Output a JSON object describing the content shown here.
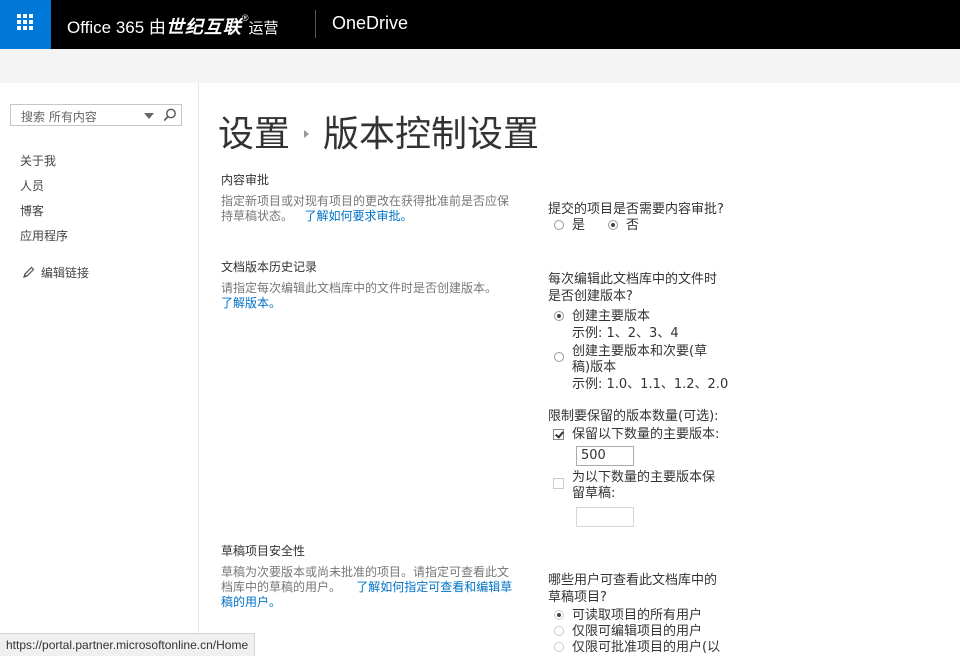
{
  "topbar": {
    "brand_prefix": "Office 365 由",
    "brand_mark": "世纪互联",
    "brand_reg": "®",
    "brand_suffix": "运营",
    "app_name": "OneDrive"
  },
  "search": {
    "placeholder": "搜索 所有内容"
  },
  "nav": {
    "items": [
      "关于我",
      "人员",
      "博客",
      "应用程序"
    ],
    "edit_links": "编辑链接"
  },
  "breadcrumb": {
    "parent": "设置",
    "current": "版本控制设置"
  },
  "sections": {
    "content_approval": {
      "heading": "内容审批",
      "description": "指定新项目或对现有项目的更改在获得批准前是否应保持草稿状态。",
      "link": "了解如何要求审批。",
      "question": "提交的项目是否需要内容审批?",
      "yes": "是",
      "no": "否",
      "selected": "no"
    },
    "version_history": {
      "heading": "文档版本历史记录",
      "description": "请指定每次编辑此文档库中的文件时是否创建版本。",
      "link": "了解版本。",
      "question": "每次编辑此文档库中的文件时是否创建版本?",
      "option_major": "创建主要版本",
      "option_major_example": "示例: 1、2、3、4",
      "option_minor": "创建主要版本和次要(草稿)版本",
      "option_minor_example": "示例: 1.0、1.1、1.2、2.0",
      "selected": "major",
      "limit_label": "限制要保留的版本数量(可选):",
      "keep_major_label": "保留以下数量的主要版本:",
      "keep_major_checked": true,
      "keep_major_value": "500",
      "keep_drafts_label": "为以下数量的主要版本保留草稿:",
      "keep_drafts_checked": false,
      "keep_drafts_value": ""
    },
    "draft_security": {
      "heading": "草稿项目安全性",
      "description": "草稿为次要版本或尚未批准的项目。请指定可查看此文档库中的草稿的用户。",
      "link": "了解如何指定可查看和编辑草稿的用户。",
      "question": "哪些用户可查看此文档库中的草稿项目?",
      "option_read": "可读取项目的所有用户",
      "option_edit": "仅限可编辑项目的用户",
      "option_approve": "仅限可批准项目的用户(以"
    }
  },
  "status_bar": {
    "url": "https://portal.partner.microsoftonline.cn/Home"
  },
  "colors": {
    "waffle": "#0078d7",
    "topbar": "#000000",
    "link": "#0072c6"
  }
}
